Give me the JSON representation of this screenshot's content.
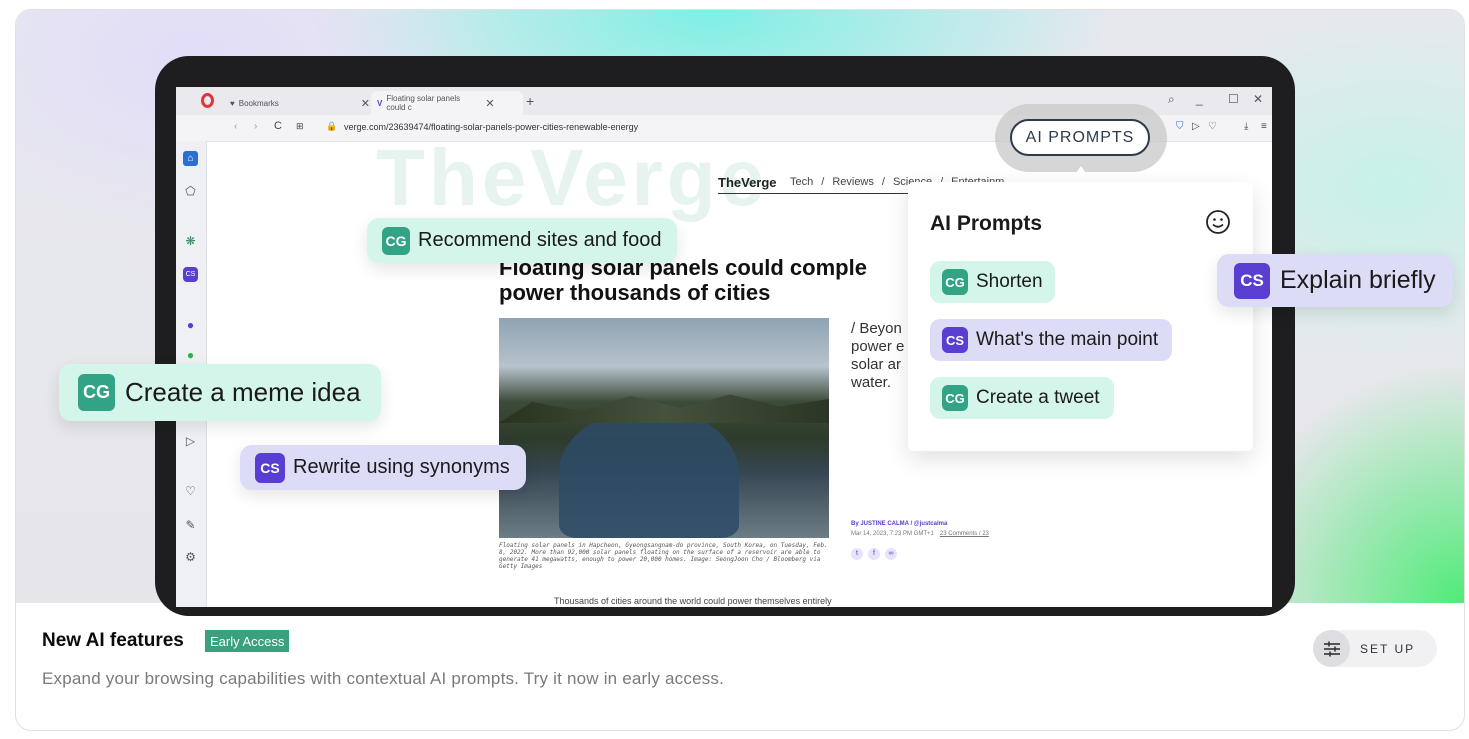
{
  "browser": {
    "tabs": [
      {
        "label": "Bookmarks"
      },
      {
        "label": "Floating solar panels could c"
      }
    ],
    "url": "verge.com/23639474/floating-solar-panels-power-cities-renewable-energy",
    "ai_prompts_button": "AI PROMPTS"
  },
  "article": {
    "site_logo": "TheVerge",
    "nav": [
      "Tech",
      "/",
      "Reviews",
      "/",
      "Science",
      "/",
      "Entertainm"
    ],
    "headline_line1": "Floating solar panels could comple",
    "headline_line2": "power thousands of cities",
    "side_text": [
      "/ Beyon",
      "power e",
      "solar ar",
      "water."
    ],
    "caption": "Floating solar panels in Hapcheon, Gyeongsangnam-do province, South Korea, on Tuesday, Feb. 8, 2022. More than 92,000 solar panels floating on the surface of a reservoir are able to generate 41 megawatts, enough to power 20,000 homes. Image: SeongJoon Cho / Bloomberg via Getty Images",
    "byline": "By JUSTINE CALMA / @justcalma",
    "dateline": "Mar 14, 2023, 7:23 PM GMT+1",
    "comments": "23 Comments / 23",
    "bottom_text": "Thousands of cities around the world could power themselves entirely"
  },
  "panel": {
    "title": "AI Prompts",
    "items": [
      {
        "badge": "CG",
        "label": "Shorten"
      },
      {
        "badge": "CS",
        "label": "What's the main point"
      },
      {
        "badge": "CG",
        "label": "Create a tweet"
      }
    ]
  },
  "floating_chips": {
    "recommend": {
      "badge": "CG",
      "label": "Recommend sites and food"
    },
    "meme": {
      "badge": "CG",
      "label": "Create a meme idea"
    },
    "synonyms": {
      "badge": "CS",
      "label": "Rewrite using synonyms"
    },
    "explain": {
      "badge": "CS",
      "label": "Explain briefly"
    }
  },
  "footer": {
    "title": "New AI features",
    "badge": "Early Access",
    "description": "Expand your browsing capabilities with contextual AI prompts. Try it now in early access.",
    "setup_label": "SET UP"
  },
  "colors": {
    "cg_badge": "#33a386",
    "cs_badge": "#5a3dd1",
    "early_access": "#3aa17f"
  }
}
